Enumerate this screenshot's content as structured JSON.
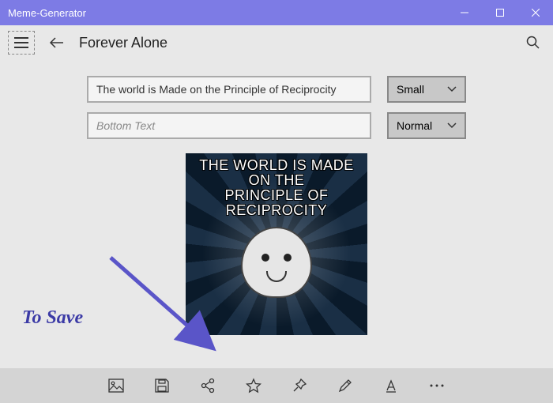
{
  "window": {
    "title": "Meme-Generator"
  },
  "header": {
    "page_title": "Forever Alone"
  },
  "inputs": {
    "top": {
      "value": "The world is Made on the Principle of Reciprocity",
      "placeholder": "Top Text",
      "size": "Small"
    },
    "bottom": {
      "value": "",
      "placeholder": "Bottom Text",
      "size": "Normal"
    }
  },
  "meme": {
    "top_text_line1": "THE WORLD IS MADE ON THE",
    "top_text_line2": "PRINCIPLE OF RECIPROCITY"
  },
  "annotation": {
    "label": "To Save"
  },
  "toolbar": {
    "image": "image-icon",
    "save": "save-icon",
    "share": "share-icon",
    "favorite": "star-icon",
    "pin": "pin-icon",
    "edit": "pencil-icon",
    "font": "font-icon",
    "more": "more-icon"
  }
}
